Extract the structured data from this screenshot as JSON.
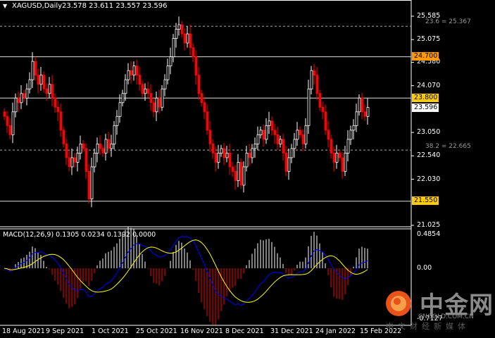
{
  "header": {
    "symbol_label": "XAGUSD,Daily",
    "ohlc": "23.578 23.611 23.557 23.596"
  },
  "macd_label": "MACD(12,26,9) 0.1305 0.0234 0.1392 0.0000",
  "price_axis": {
    "ticks": [
      "25.585",
      "25.075",
      "24.580",
      "24.070",
      "23.050",
      "22.540",
      "22.030",
      "21.025"
    ],
    "tick_values": [
      25.585,
      25.075,
      24.58,
      24.07,
      23.05,
      22.54,
      22.03,
      21.025
    ]
  },
  "levels": [
    {
      "label": "24.700",
      "value": 24.7,
      "color": "#ff9900"
    },
    {
      "label": "23.800",
      "value": 23.8,
      "color": "#ffcc00"
    },
    {
      "label": "21.550",
      "value": 21.55,
      "color": "#ffcc00"
    }
  ],
  "current_price": {
    "label": "23.596",
    "value": 23.596
  },
  "fib_levels": [
    {
      "label": "23.6 = 25.367",
      "value": 25.367
    },
    {
      "label": "38.2 = 22.665",
      "value": 22.665
    }
  ],
  "macd_axis": {
    "top": "0.4854",
    "zero": "0.00",
    "bottom": "-0.7127"
  },
  "dates": [
    "18 Aug 2021",
    "9 Sep 2021",
    "1 Oct 2021",
    "25 Oct 2021",
    "16 Nov 2021",
    "8 Dec 2021",
    "31 Dec 2021",
    "24 Jan 2022",
    "15 Feb 2022"
  ],
  "watermark": {
    "brand": "中金网",
    "domain": "CNGOLD.COM.CN",
    "slogan": "中文财经新媒体"
  },
  "colors": {
    "bull": "#ffffff",
    "bear": "#ff0000",
    "macd_line": "#0000ff",
    "signal_line": "#ffff00",
    "hist_pos": "#ffffff",
    "hist_neg": "#ff0000"
  },
  "chart_data": {
    "type": "candlestick",
    "symbol": "XAGUSD",
    "timeframe": "Daily",
    "ylim": [
      21.025,
      25.585
    ],
    "macd_ylim": [
      -0.7127,
      0.4854
    ],
    "closes": [
      23.4,
      23.2,
      23.0,
      23.5,
      23.8,
      23.7,
      23.9,
      23.8,
      24.0,
      24.2,
      24.6,
      24.3,
      24.1,
      24.3,
      24.0,
      23.9,
      24.1,
      23.8,
      23.6,
      23.5,
      23.1,
      22.8,
      22.5,
      22.3,
      22.5,
      22.4,
      22.6,
      22.8,
      22.7,
      22.2,
      21.6,
      22.3,
      22.6,
      22.8,
      22.7,
      22.6,
      22.9,
      22.7,
      22.8,
      23.2,
      23.4,
      23.7,
      23.9,
      24.2,
      24.4,
      24.3,
      24.5,
      24.3,
      24.1,
      23.9,
      24.0,
      23.9,
      23.7,
      23.5,
      23.8,
      23.6,
      24.0,
      24.2,
      24.5,
      24.7,
      25.1,
      25.3,
      25.4,
      25.2,
      25.0,
      25.2,
      24.9,
      24.7,
      24.3,
      23.9,
      23.7,
      23.5,
      23.1,
      22.8,
      22.6,
      22.4,
      22.6,
      22.7,
      22.5,
      22.6,
      22.3,
      22.2,
      22.0,
      22.4,
      21.9,
      22.3,
      22.6,
      22.5,
      22.7,
      22.8,
      23.0,
      23.1,
      22.9,
      23.2,
      23.3,
      23.1,
      23.0,
      22.8,
      22.9,
      22.6,
      22.2,
      22.5,
      22.7,
      22.9,
      23.1,
      23.0,
      22.8,
      23.2,
      24.0,
      24.4,
      24.3,
      23.9,
      23.6,
      23.5,
      23.1,
      22.9,
      22.6,
      22.4,
      22.6,
      22.5,
      22.2,
      22.6,
      22.9,
      23.1,
      23.2,
      23.5,
      23.8,
      23.5,
      23.4,
      23.596
    ]
  }
}
